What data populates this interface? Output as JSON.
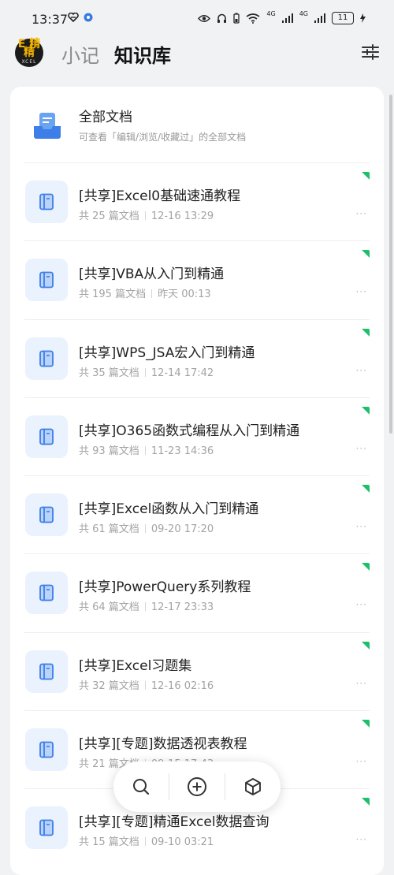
{
  "status_bar": {
    "time": "13:37",
    "battery_level": "11",
    "net_label_1": "4G",
    "net_label_2": "4G"
  },
  "header": {
    "logo_text_top": "E 精精",
    "logo_text_bottom": "XCEL",
    "tab_notes": "小记",
    "tab_knowledge_base": "知识库"
  },
  "all_docs": {
    "title": "全部文档",
    "description": "可查看「编辑/浏览/收藏过」的全部文档"
  },
  "documents": [
    {
      "title": "[共享]Excel0基础速通教程",
      "count": "共 25 篇文档",
      "time": "12-16 13:29"
    },
    {
      "title": "[共享]VBA从入门到精通",
      "count": "共 195 篇文档",
      "time": "昨天 00:13"
    },
    {
      "title": "[共享]WPS_JSA宏入门到精通",
      "count": "共 35 篇文档",
      "time": "12-14 17:42"
    },
    {
      "title": "[共享]O365函数式编程从入门到精通",
      "count": "共 93 篇文档",
      "time": "11-23 14:36"
    },
    {
      "title": "[共享]Excel函数从入门到精通",
      "count": "共 61 篇文档",
      "time": "09-20 17:20"
    },
    {
      "title": "[共享]PowerQuery系列教程",
      "count": "共 64 篇文档",
      "time": "12-17 23:33"
    },
    {
      "title": "[共享]Excel习题集",
      "count": "共 32 篇文档",
      "time": "12-16 02:16"
    },
    {
      "title": "[共享][专题]数据透视表教程",
      "count": "共 21 篇文档",
      "time": "09-15 17:43"
    },
    {
      "title": "[共享][专题]精通Excel数据查询",
      "count": "共 15 篇文档",
      "time": "09-10 03:21"
    }
  ],
  "more_glyph": "···",
  "colors": {
    "accent_blue": "#3d7ee8",
    "icon_bg": "#eaf2fe",
    "shared_green": "#1fbf6a"
  }
}
